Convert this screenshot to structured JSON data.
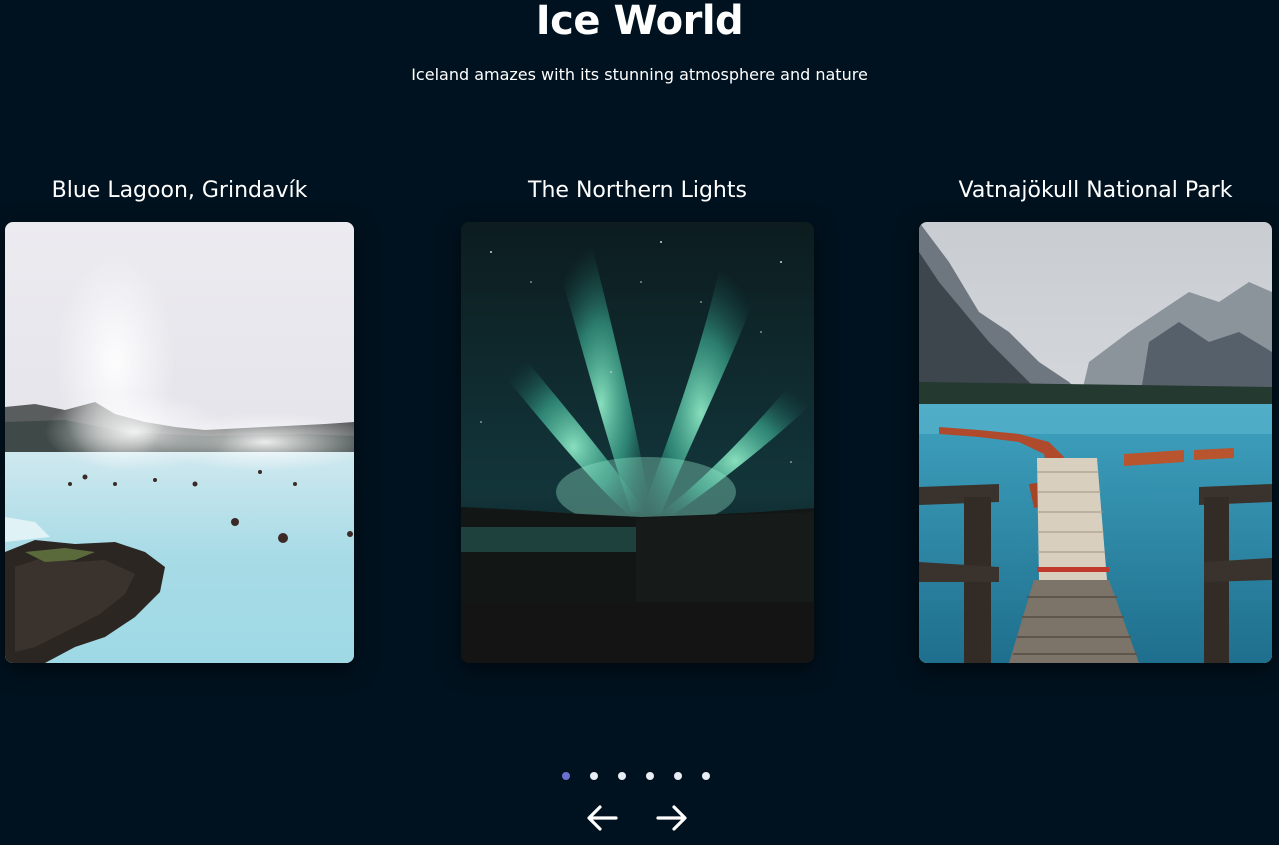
{
  "header": {
    "title": "Ice World",
    "subtitle": "Iceland amazes with its stunning atmosphere and nature"
  },
  "slides": [
    {
      "title": "Blue Lagoon, Grindavík",
      "image": "blue-lagoon-photo"
    },
    {
      "title": "The Northern Lights",
      "image": "northern-lights-photo"
    },
    {
      "title": "Vatnajökull National Park",
      "image": "lake-pier-photo"
    }
  ],
  "pagination": {
    "count": 6,
    "active_index": 0
  },
  "colors": {
    "background": "#00121f",
    "active_dot": "#6f6fd0",
    "dot": "#e9eef6"
  }
}
